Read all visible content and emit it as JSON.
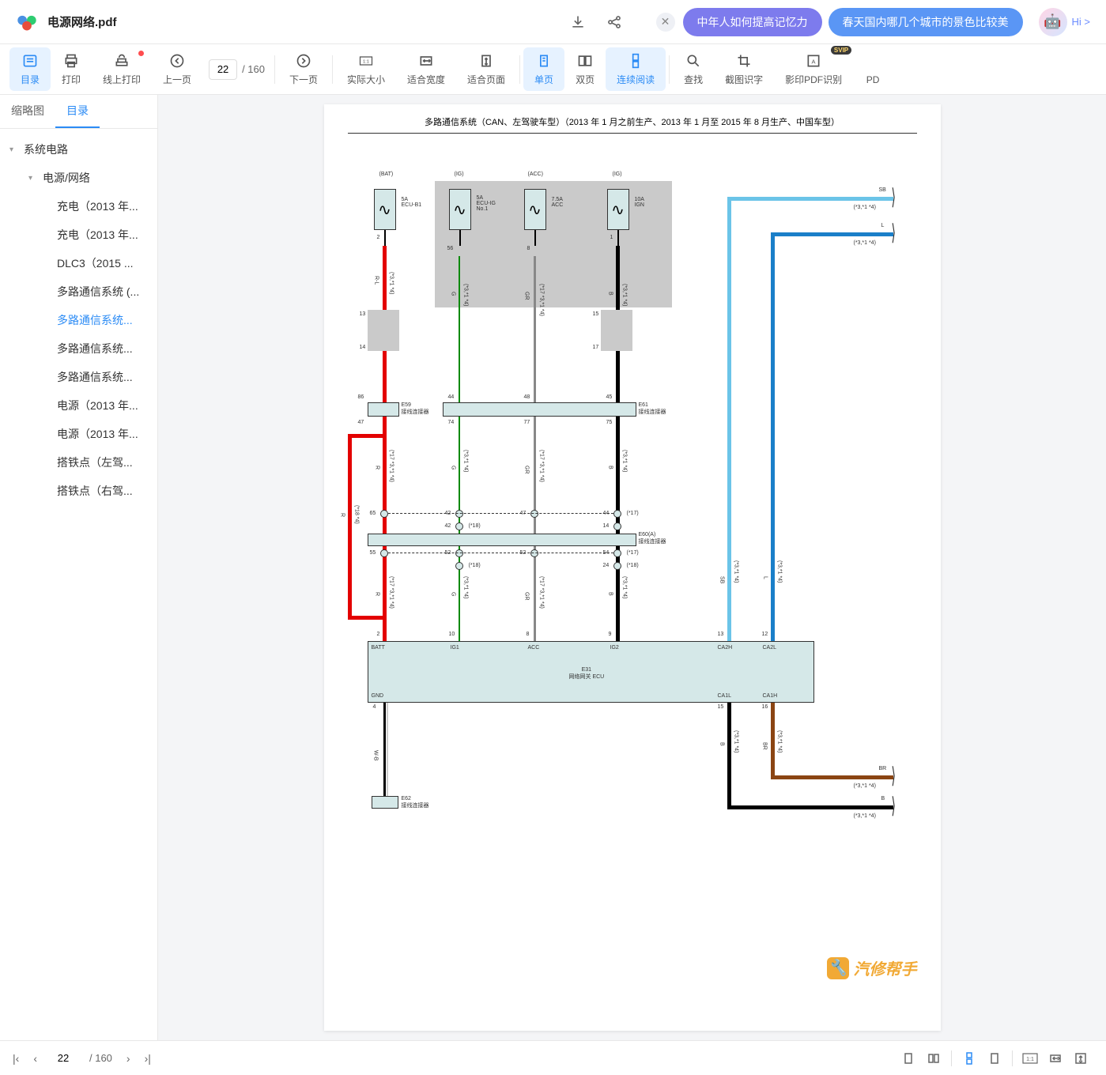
{
  "header": {
    "file_title": "电源网络.pdf",
    "ad_pills": [
      "中年人如何提高记忆力",
      "春天国内哪几个城市的景色比较美"
    ],
    "hi_label": "Hi >"
  },
  "toolbar": {
    "buttons": [
      {
        "label": "目录",
        "icon": "toc",
        "active": true
      },
      {
        "label": "打印",
        "icon": "print"
      },
      {
        "label": "线上打印",
        "icon": "cloud-print",
        "red_dot": true
      },
      {
        "label": "上一页",
        "icon": "prev"
      },
      {
        "label": "下一页",
        "icon": "next"
      },
      {
        "label": "实际大小",
        "icon": "actual"
      },
      {
        "label": "适合宽度",
        "icon": "fit-width"
      },
      {
        "label": "适合页面",
        "icon": "fit-page"
      },
      {
        "label": "单页",
        "icon": "single",
        "active": true
      },
      {
        "label": "双页",
        "icon": "double"
      },
      {
        "label": "连续阅读",
        "icon": "continuous",
        "active": true
      },
      {
        "label": "查找",
        "icon": "search"
      },
      {
        "label": "截图识字",
        "icon": "crop"
      },
      {
        "label": "影印PDF识别",
        "icon": "ocr",
        "svip": true
      },
      {
        "label": "PD",
        "icon": "more"
      }
    ],
    "page_current": "22",
    "page_total": "/ 160"
  },
  "sidebar": {
    "tabs": [
      "缩略图",
      "目录"
    ],
    "active_tab": 1,
    "tree": [
      {
        "label": "系统电路",
        "level": 0,
        "expanded": true
      },
      {
        "label": "电源/网络",
        "level": 1,
        "expanded": true
      },
      {
        "label": "充电（2013 年...",
        "level": 2
      },
      {
        "label": "充电（2013 年...",
        "level": 2
      },
      {
        "label": "DLC3（2015 ...",
        "level": 2
      },
      {
        "label": "多路通信系统 (...",
        "level": 2
      },
      {
        "label": "多路通信系统...",
        "level": 2,
        "selected": true
      },
      {
        "label": "多路通信系统...",
        "level": 2
      },
      {
        "label": "多路通信系统...",
        "level": 2
      },
      {
        "label": "电源（2013 年...",
        "level": 2
      },
      {
        "label": "电源（2013 年...",
        "level": 2
      },
      {
        "label": "搭铁点（左驾...",
        "level": 2
      },
      {
        "label": "搭铁点（右驾...",
        "level": 2
      }
    ]
  },
  "document": {
    "page_title": "多路通信系统（CAN、左驾驶车型）（2013 年 1 月之前生产、2013 年 1 月至 2015 年 8 月生产、中国车型）",
    "power_labels": [
      "(BAT)",
      "(IG)",
      "(ACC)",
      "(IG)"
    ],
    "fuse_labels": [
      "5A\nECU-B1",
      "5A\nECU-IG\nNo.1",
      "7.5A\nACC",
      "10A\nIGN"
    ],
    "wire_colors": {
      "red": "R-L",
      "green": "G",
      "grey": "GR",
      "black1": "B",
      "black2": "B",
      "skyblue": "SB",
      "blue": "L",
      "brown": "BR",
      "whiteblack": "W-B"
    },
    "wire_refs": {
      "ref1": "(*3,*1 *4)",
      "ref2": "(*17 *3,*1 *4)",
      "ref3": "(*3,*1 *4)"
    },
    "pin_numbers": {
      "p1": "2",
      "p2": "56",
      "p3": "8",
      "p4": "1",
      "p5": "13",
      "p6": "14",
      "p7": "15",
      "p8": "17",
      "p9": "86",
      "p10": "44",
      "p11": "48",
      "p12": "45",
      "p13": "47",
      "p14": "74",
      "p15": "77",
      "p16": "75",
      "p17": "65",
      "p18": "42",
      "p19": "47",
      "p20": "44",
      "p21": "42",
      "p22": "14",
      "p23": "55",
      "p24": "52",
      "p25": "52",
      "p26": "54",
      "p27": "24",
      "p28": "10",
      "p29": "8",
      "p30": "9",
      "p31": "13",
      "p32": "12",
      "p33": "4",
      "p34": "15",
      "p35": "16"
    },
    "connectors": {
      "e59": "E59\n接线连接器",
      "e61": "E61\n接线连接器",
      "e60": "E60(A)\n接线连接器",
      "e62": "E62\n接线连接器"
    },
    "ecu": {
      "name": "E31\n网络网关 ECU",
      "pins": [
        "BATT",
        "IG1",
        "ACC",
        "IG2",
        "CA2H",
        "CA2L",
        "GND",
        "CA1L",
        "CA1H"
      ]
    },
    "annotations": {
      "a17": "(*17)",
      "a18": "(*18)",
      "a18_4": "(*18 *4)"
    },
    "watermark": "汽修帮手"
  },
  "footer": {
    "page_current": "22",
    "page_total": "/ 160"
  }
}
